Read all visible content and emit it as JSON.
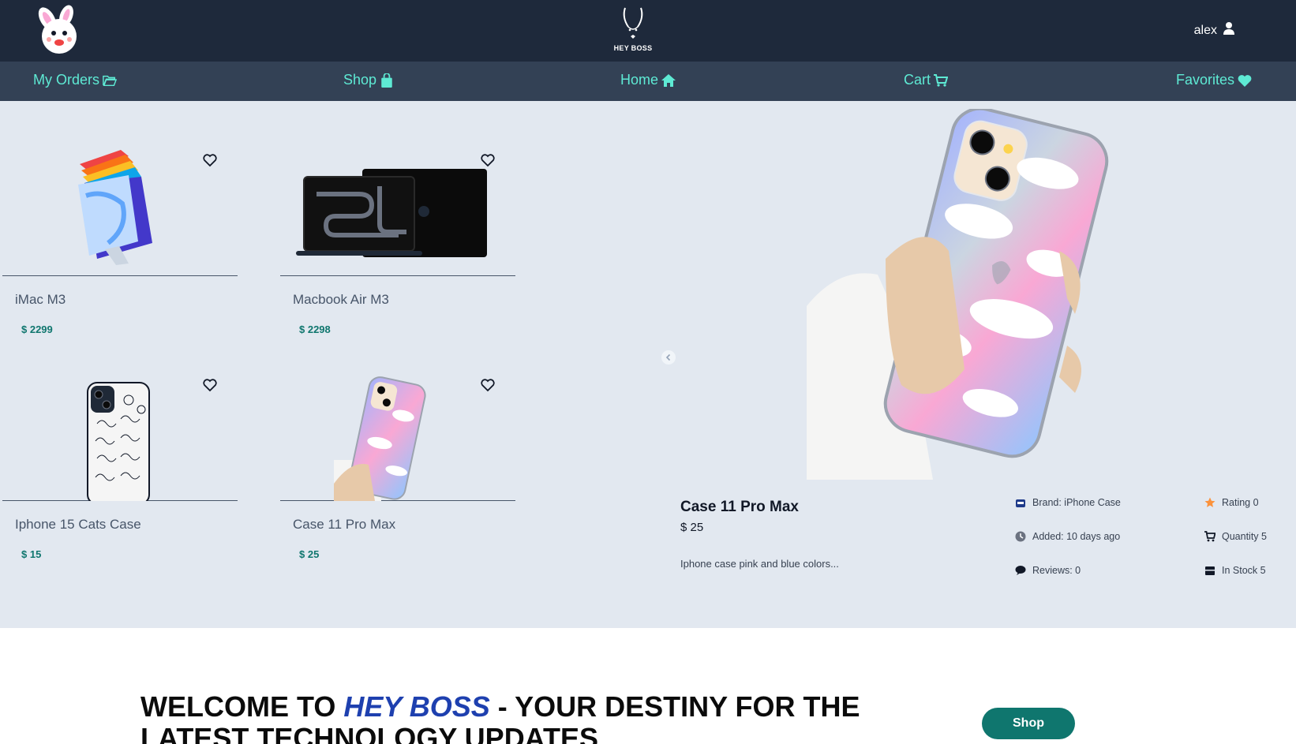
{
  "header": {
    "logo_center_text": "HEY BOSS",
    "user_name": "alex"
  },
  "nav": [
    {
      "label": "My Orders",
      "icon": "folder-open-icon"
    },
    {
      "label": "Shop",
      "icon": "shopping-bag-icon"
    },
    {
      "label": "Home",
      "icon": "home-icon"
    },
    {
      "label": "Cart",
      "icon": "cart-icon"
    },
    {
      "label": "Favorites",
      "icon": "heart-icon"
    }
  ],
  "products": [
    {
      "title": "iMac M3",
      "price": "$ 2299"
    },
    {
      "title": "Macbook Air M3",
      "price": "$ 2298"
    },
    {
      "title": "Iphone 15 Cats Case",
      "price": "$ 15"
    },
    {
      "title": "Case 11 Pro Max",
      "price": "$ 25"
    }
  ],
  "featured": {
    "title": "Case 11 Pro Max",
    "price": "$ 25",
    "description": "Iphone case pink and blue colors...",
    "brand": "Brand: iPhone Case",
    "added": "Added: 10 days ago",
    "reviews": "Reviews: 0",
    "rating": "Rating 0",
    "quantity": "Quantity 5",
    "stock": "In Stock 5"
  },
  "welcome": {
    "prefix": "WELCOME TO ",
    "brand": "HEY BOSS",
    "suffix": " - YOUR DESTINY FOR THE LATEST TECHNOLOGY UPDATES"
  },
  "shop_button": "Shop",
  "colors": {
    "header_bg": "#1e293b",
    "nav_bg": "#334155",
    "accent": "#5eead4",
    "main_bg": "#e2e8f0",
    "price": "#0f766e",
    "brand": "#1e40af",
    "button": "#0f766e"
  }
}
